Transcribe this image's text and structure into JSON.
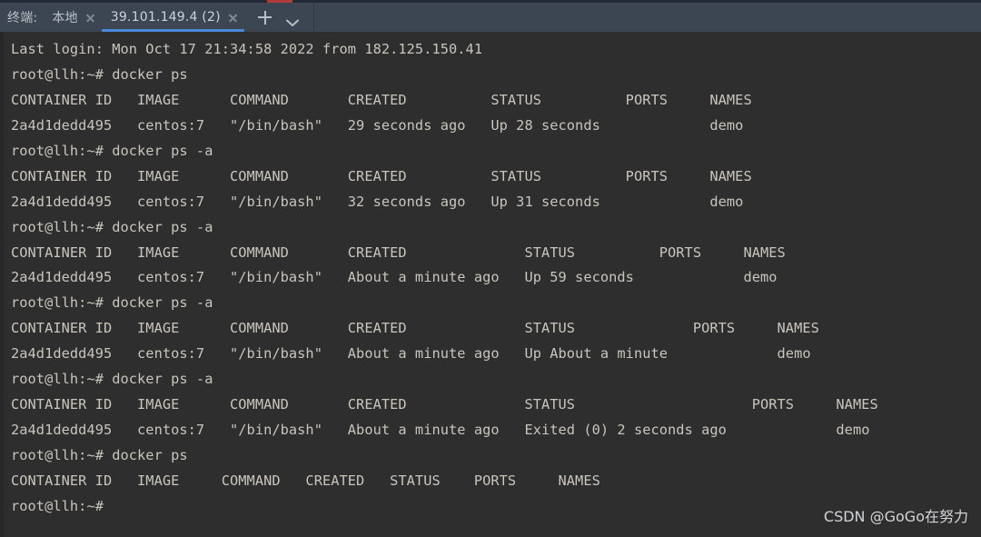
{
  "window": {
    "tabbar_label": "终端:",
    "accent_blue": "#4a88d8",
    "tabbar_bg": "#3c4652",
    "terminal_bg": "#2e2e2e",
    "terminal_fg": "#c9c5bd"
  },
  "tabs": [
    {
      "title": "本地",
      "active": false,
      "close_icon": "close-icon"
    },
    {
      "title": "39.101.149.4 (2)",
      "active": true,
      "close_icon": "close-icon"
    }
  ],
  "tab_actions": [
    {
      "name": "new-tab-button",
      "icon": "plus-icon"
    },
    {
      "name": "tab-list-dropdown-button",
      "icon": "chevron-down-icon"
    }
  ],
  "terminal": {
    "lines": [
      "Last login: Mon Oct 17 21:34:58 2022 from 182.125.150.41",
      "root@llh:~# docker ps",
      "CONTAINER ID   IMAGE      COMMAND       CREATED          STATUS          PORTS     NAMES",
      "2a4d1dedd495   centos:7   \"/bin/bash\"   29 seconds ago   Up 28 seconds             demo",
      "root@llh:~# docker ps -a",
      "CONTAINER ID   IMAGE      COMMAND       CREATED          STATUS          PORTS     NAMES",
      "2a4d1dedd495   centos:7   \"/bin/bash\"   32 seconds ago   Up 31 seconds             demo",
      "root@llh:~# docker ps -a",
      "CONTAINER ID   IMAGE      COMMAND       CREATED              STATUS          PORTS     NAMES",
      "2a4d1dedd495   centos:7   \"/bin/bash\"   About a minute ago   Up 59 seconds             demo",
      "root@llh:~# docker ps -a",
      "CONTAINER ID   IMAGE      COMMAND       CREATED              STATUS              PORTS     NAMES",
      "2a4d1dedd495   centos:7   \"/bin/bash\"   About a minute ago   Up About a minute             demo",
      "root@llh:~# docker ps -a",
      "CONTAINER ID   IMAGE      COMMAND       CREATED              STATUS                     PORTS     NAMES",
      "2a4d1dedd495   centos:7   \"/bin/bash\"   About a minute ago   Exited (0) 2 seconds ago             demo",
      "root@llh:~# docker ps",
      "CONTAINER ID   IMAGE     COMMAND   CREATED   STATUS    PORTS     NAMES",
      "root@llh:~#"
    ]
  },
  "watermark": {
    "text": "CSDN @GoGo在努力"
  }
}
